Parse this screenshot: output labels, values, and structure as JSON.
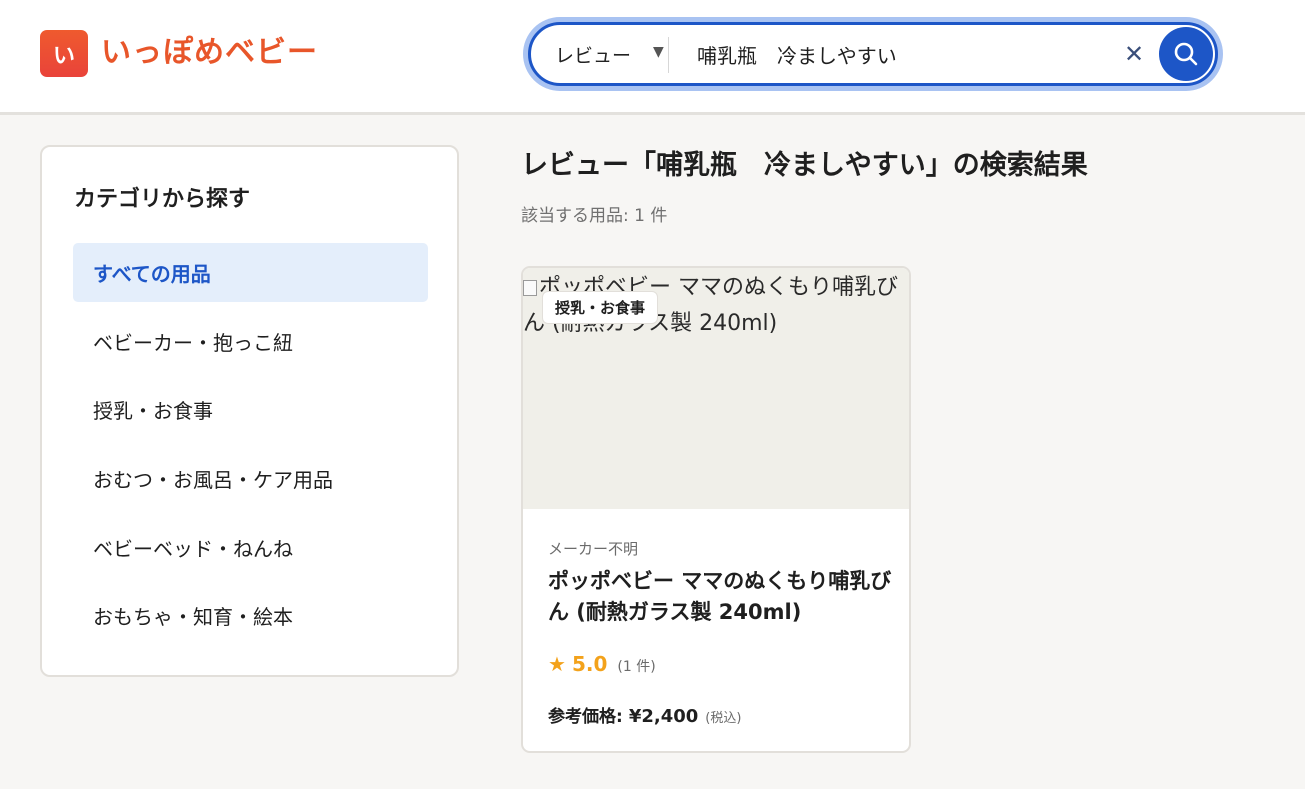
{
  "header": {
    "logo_mark": "い",
    "logo_text": "いっぽめベビー",
    "search": {
      "scope": "レビュー",
      "query": "哺乳瓶　冷ましやすい",
      "clear_icon": "close-icon",
      "search_icon": "search-icon"
    }
  },
  "sidebar": {
    "title": "カテゴリから探す",
    "items": [
      {
        "label": "すべての用品",
        "active": true
      },
      {
        "label": "ベビーカー・抱っこ紐"
      },
      {
        "label": "授乳・お食事"
      },
      {
        "label": "おむつ・お風呂・ケア用品"
      },
      {
        "label": "ベビーベッド・ねんね"
      },
      {
        "label": "おもちゃ・知育・絵本"
      }
    ]
  },
  "results": {
    "title": "レビュー「哺乳瓶　冷ましやすい」の検索結果",
    "count_text": "該当する用品: 1 件",
    "items": [
      {
        "image_alt": "ポッポベビー ママのぬくもり哺乳びん (耐熱ガラス製 240ml)",
        "category_tag": "授乳・お食事",
        "maker": "メーカー不明",
        "name": "ポッポベビー ママのぬくもり哺乳びん (耐熱ガラス製 240ml)",
        "rating_star": "★",
        "rating": "5.0",
        "review_count": "(1 件)",
        "price_label": "参考価格:",
        "price": "¥2,400",
        "tax_note": "(税込)"
      }
    ]
  },
  "colors": {
    "brand": "#e8562a",
    "accent": "#1d56c7",
    "star": "#f3a21b"
  }
}
